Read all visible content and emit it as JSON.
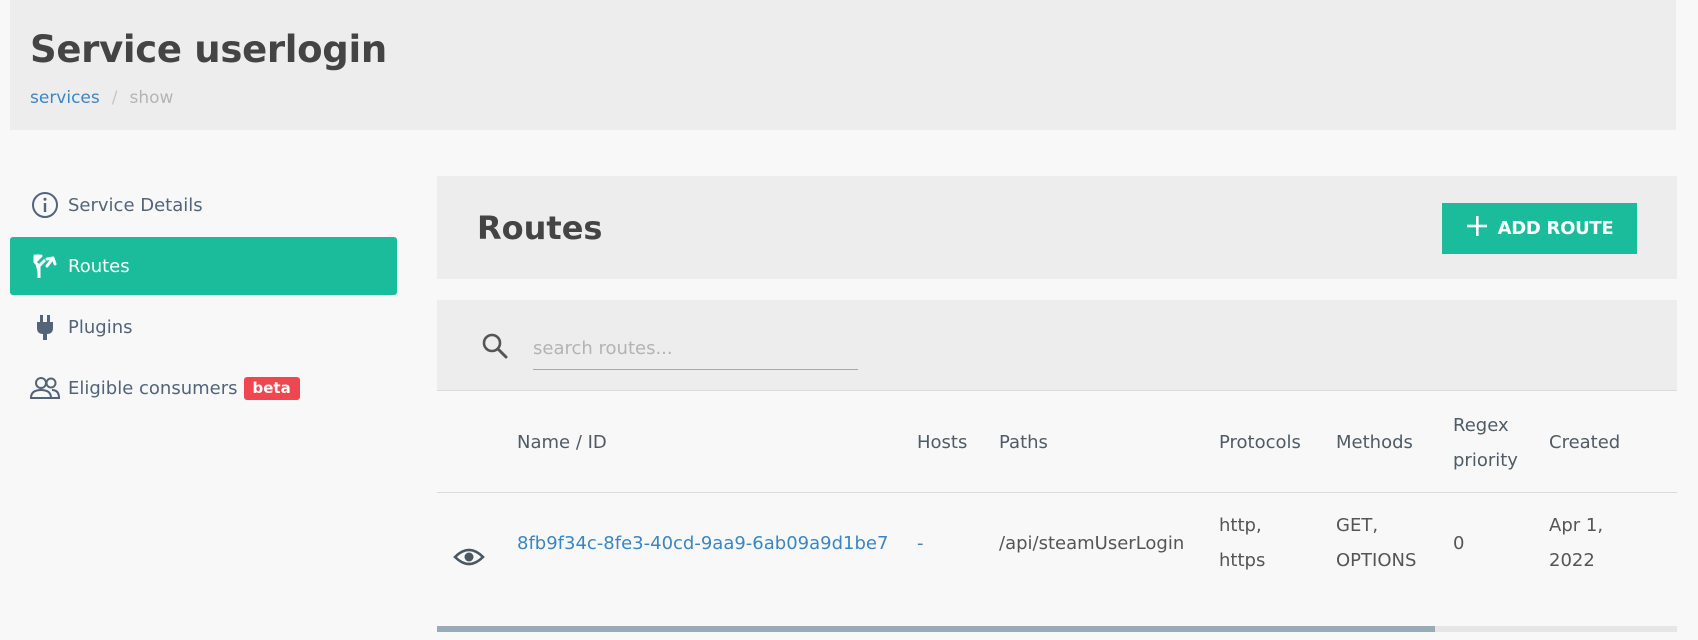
{
  "header": {
    "title": "Service userlogin",
    "breadcrumb": [
      {
        "label": "services"
      },
      {
        "label": "show"
      }
    ],
    "separator": "/"
  },
  "sidebar": {
    "items": [
      {
        "label": "Service Details",
        "icon": "info-icon",
        "active": false
      },
      {
        "label": "Routes",
        "icon": "routes-icon",
        "active": true
      },
      {
        "label": "Plugins",
        "icon": "plug-icon",
        "active": false
      },
      {
        "label": "Eligible consumers",
        "icon": "users-icon",
        "active": false,
        "badge": "beta"
      }
    ]
  },
  "routes": {
    "title": "Routes",
    "add_label": "ADD ROUTE",
    "search_placeholder": "search routes...",
    "columns": [
      "Name / ID",
      "Hosts",
      "Paths",
      "Protocols",
      "Methods",
      "Regex priority",
      "Created"
    ],
    "rows": [
      {
        "id": "8fb9f34c-8fe3-40cd-9aa9-6ab09a9d1be7",
        "hosts": "-",
        "paths": "/api/steamUserLogin",
        "protocols": [
          "http,",
          "https"
        ],
        "methods": [
          "GET,",
          "OPTIONS"
        ],
        "regex_priority": "0",
        "created": [
          "Apr 1,",
          "2022"
        ]
      }
    ]
  },
  "colors": {
    "accent": "#1abc9c",
    "link": "#3a86c4",
    "badge": "#f0464f"
  }
}
